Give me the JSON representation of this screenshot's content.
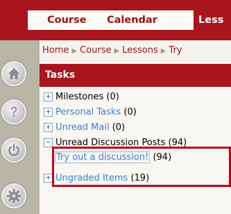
{
  "nav": {
    "tabs": [
      {
        "label": "Course"
      },
      {
        "label": "Calendar"
      },
      {
        "label": "Less"
      }
    ]
  },
  "breadcrumb": {
    "items": [
      "Home",
      "Course",
      "Lessons",
      "Try"
    ],
    "separator": "▶"
  },
  "tasks": {
    "title": "Tasks",
    "rows": [
      {
        "toggle": "+",
        "label": "Milestones",
        "count": "(0)"
      },
      {
        "toggle": "+",
        "label": "Personal Tasks",
        "count": "(0)"
      },
      {
        "toggle": "+",
        "label": "Unread Mail",
        "count": "(0)"
      },
      {
        "toggle": "−",
        "label": "Unread Discussion Posts",
        "count": "(94)"
      },
      {
        "toggle": "+",
        "label": "Ungraded Items",
        "count": "(19)"
      }
    ],
    "sub_item": {
      "label": "Try out a discussion!",
      "count": "(94)"
    }
  },
  "sidebar": {
    "icons": [
      "home-icon",
      "help-icon",
      "power-icon",
      "settings-icon"
    ]
  },
  "colors": {
    "brand_red": "#a8151c",
    "link_blue": "#3a7fd0",
    "highlight_red": "#c0001a"
  }
}
